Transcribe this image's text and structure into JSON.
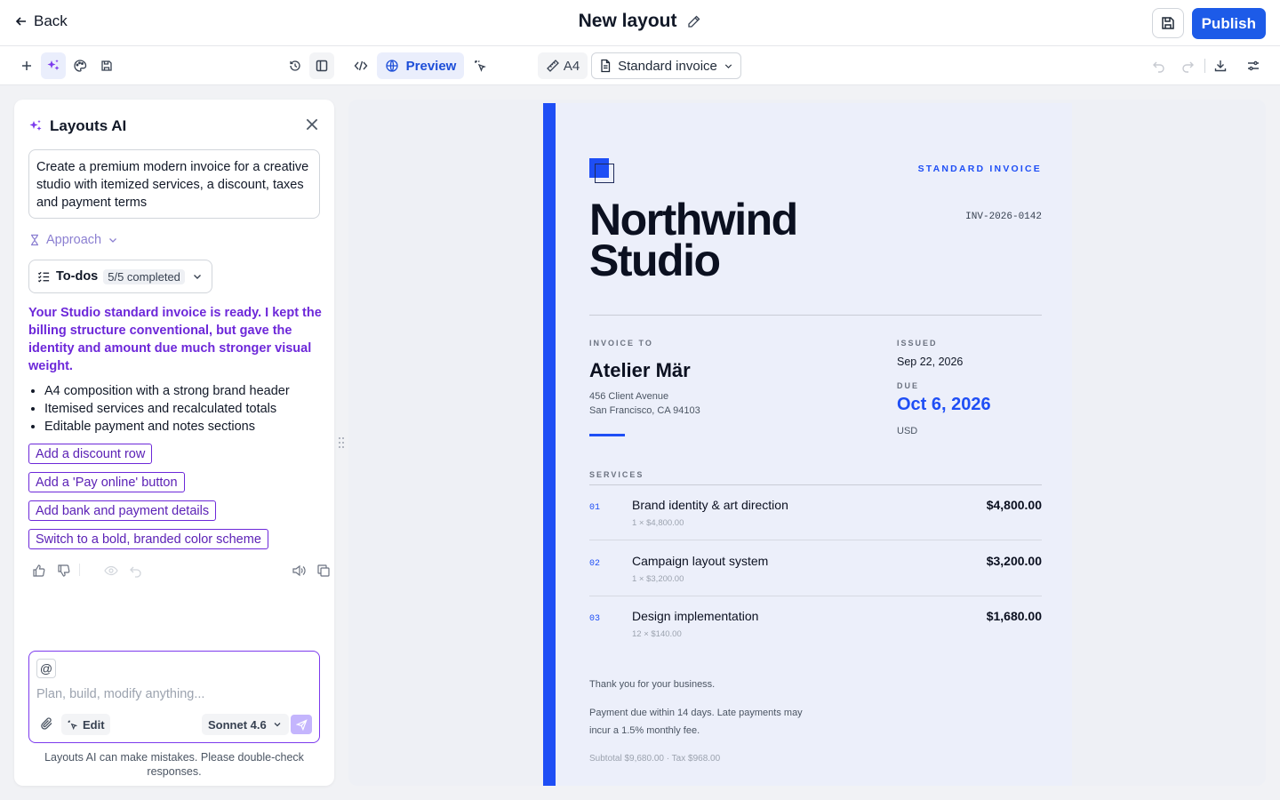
{
  "header": {
    "back_label": "Back",
    "title": "New layout",
    "publish_label": "Publish"
  },
  "toolbar": {
    "preview_label": "Preview",
    "page_size": "A4",
    "template": "Standard invoice"
  },
  "ai_panel": {
    "title": "Layouts AI",
    "prompt": "Create a premium modern invoice for a creative studio with itemized services, a discount, taxes and payment terms",
    "approach_label": "Approach",
    "todos_label": "To-dos",
    "todos_status": "5/5 completed",
    "message": "Your Studio standard invoice is ready. I kept the billing structure conventional, but gave the identity and amount due much stronger visual weight.",
    "bullets": [
      "A4 composition with a strong brand header",
      "Itemised services and recalculated totals",
      "Editable payment and notes sections"
    ],
    "suggestions": [
      "Add a discount row",
      "Add a 'Pay online' button",
      "Add bank and payment details",
      "Switch to a bold, branded color scheme"
    ],
    "input_placeholder": "Plan, build, modify anything...",
    "mention_symbol": "@",
    "mode_label": "Edit",
    "model_label": "Sonnet 4.6",
    "disclaimer": "Layouts AI can make mistakes. Please double-check responses."
  },
  "invoice": {
    "kicker": "STANDARD INVOICE",
    "company_line1": "Northwind",
    "company_line2": "Studio",
    "number": "INV-2026-0142",
    "bill_to_label": "INVOICE TO",
    "client_name": "Atelier Mär",
    "client_address_1": "456 Client Avenue",
    "client_address_2": "San Francisco, CA 94103",
    "issued_label": "ISSUED",
    "issued_date": "Sep 22, 2026",
    "due_label": "DUE",
    "due_date": "Oct 6, 2026",
    "currency": "USD",
    "services_label": "SERVICES",
    "services": [
      {
        "num": "01",
        "name": "Brand identity & art direction",
        "qty": "1 × $4,800.00",
        "amount": "$4,800.00"
      },
      {
        "num": "02",
        "name": "Campaign layout system",
        "qty": "1 × $3,200.00",
        "amount": "$3,200.00"
      },
      {
        "num": "03",
        "name": "Design implementation",
        "qty": "12 × $140.00",
        "amount": "$1,680.00"
      }
    ],
    "thanks": "Thank you for your business.",
    "terms_1": "Payment due within 14 days. Late payments may",
    "terms_2": "incur a 1.5% monthly fee.",
    "totals": "Subtotal $9,680.00 · Tax $968.00"
  },
  "colors": {
    "accent": "#1e4ef5",
    "ai_purple": "#6d28d9",
    "publish": "#1d5be8"
  }
}
